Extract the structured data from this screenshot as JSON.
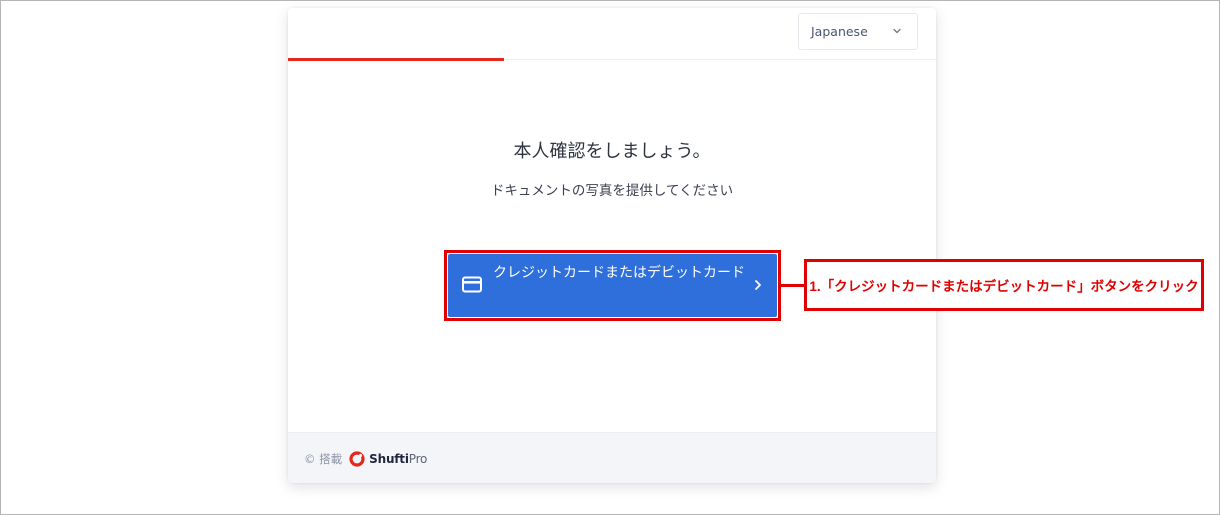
{
  "header": {
    "language_selected": "Japanese",
    "progress_fraction": 0.333
  },
  "main": {
    "title": "本人確認をしましょう。",
    "subtitle": "ドキュメントの写真を提供してください",
    "card_button_label": "クレジットカードまたはデビットカード"
  },
  "annotation": {
    "text": "1.「クレジットカードまたはデビットカード」ボタンをクリック"
  },
  "footer": {
    "powered_by": "© 搭載",
    "brand_primary": "Shufti",
    "brand_secondary": "Pro"
  },
  "colors": {
    "accent_red": "#e5271c",
    "button_blue": "#2f6fdc",
    "annotation_red": "#e00000"
  },
  "icons": [
    "chevron-down-icon",
    "credit-card-icon",
    "chevron-right-icon",
    "shuftipro-logo-icon"
  ]
}
